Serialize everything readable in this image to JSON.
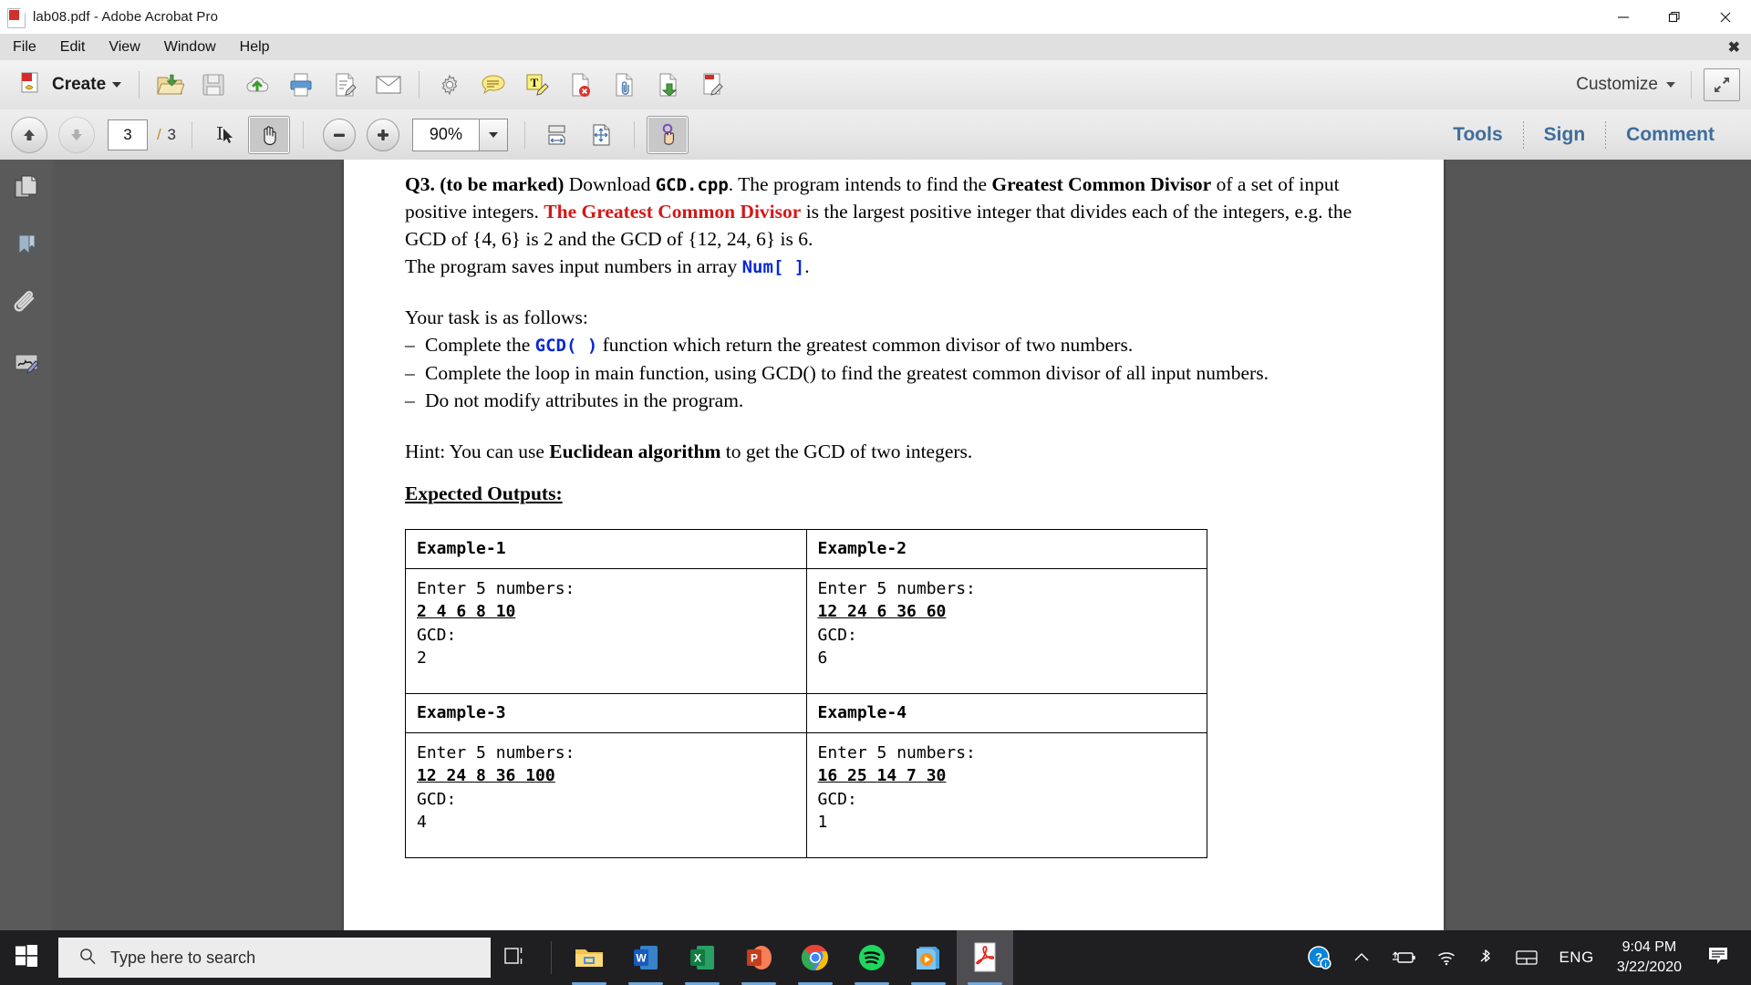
{
  "window": {
    "title": "lab08.pdf - Adobe Acrobat Pro",
    "app_icon": "acrobat-icon",
    "minimize": "—",
    "restore": "restore-icon",
    "close": "✕"
  },
  "menubar": {
    "items": [
      {
        "label": "File"
      },
      {
        "label": "Edit"
      },
      {
        "label": "View"
      },
      {
        "label": "Window"
      },
      {
        "label": "Help"
      }
    ],
    "close_doc": "✖"
  },
  "toolbar_main": {
    "create_label": "Create",
    "create_icon": "create-pdf-icon",
    "buttons": [
      {
        "name": "open-file-icon",
        "tip": "Open"
      },
      {
        "name": "save-icon",
        "tip": "Save"
      },
      {
        "name": "upload-cloud-icon",
        "tip": "Send for Signature"
      },
      {
        "name": "print-icon",
        "tip": "Print File"
      },
      {
        "name": "edit-text-icon",
        "tip": "Edit PDF"
      },
      {
        "name": "email-icon",
        "tip": "Email File"
      },
      {
        "name": "gear-icon",
        "tip": "Tools Settings"
      },
      {
        "name": "sticky-note-icon",
        "tip": "Add Sticky Note"
      },
      {
        "name": "highlight-text-icon",
        "tip": "Highlight Text"
      },
      {
        "name": "delete-page-icon",
        "tip": "Delete Pages"
      },
      {
        "name": "attach-file-icon",
        "tip": "Attach File"
      },
      {
        "name": "export-page-icon",
        "tip": "Export PDF"
      },
      {
        "name": "edit-pdf-icon",
        "tip": "Edit Document"
      }
    ],
    "customize_label": "Customize",
    "expand_icon": "expand-arrows-icon"
  },
  "toolbar_nav": {
    "prev_page_icon": "arrow-up-icon",
    "next_page_icon": "arrow-down-icon",
    "current_page": "3",
    "separator": "/",
    "total_pages": "3",
    "select_tool_icon": "text-select-icon",
    "hand_tool_icon": "hand-tool-icon",
    "zoom_out_icon": "minus-icon",
    "zoom_in_icon": "plus-icon",
    "zoom_value": "90%",
    "zoom_dropdown_icon": "chevron-down-icon",
    "fit_width_icon": "fit-width-icon",
    "fit_page_icon": "fit-page-icon",
    "pan_tool_icon": "pan-click-icon",
    "tabs": [
      {
        "label": "Tools"
      },
      {
        "label": "Sign"
      },
      {
        "label": "Comment"
      }
    ]
  },
  "sidebar": {
    "items": [
      {
        "name": "page-thumbnails-icon",
        "label": "Page Thumbnails"
      },
      {
        "name": "bookmarks-icon",
        "label": "Bookmarks"
      },
      {
        "name": "attachments-icon",
        "label": "Attachments"
      },
      {
        "name": "signatures-icon",
        "label": "Signatures"
      }
    ]
  },
  "document": {
    "q3": {
      "label": "Q3. (to be marked)",
      "t1": " Download ",
      "file": "GCD.cpp",
      "t2": ". The program intends to find the ",
      "bold1": "Greatest Common Divisor",
      "t3": " of a set of input positive integers. ",
      "red": "The Greatest Common Divisor",
      "t4": " is the largest positive integer that divides each of the integers, e.g. the GCD of {4, 6} is 2 and the GCD of {12, 24, 6} is 6."
    },
    "array_line": {
      "t1": "The program saves input numbers in array ",
      "code": "Num[ ]",
      "t2": "."
    },
    "task_heading": "Your task is as follows:",
    "tasks": [
      {
        "pre": "Complete the ",
        "code": "GCD( )",
        "post": " function which return the greatest common divisor of two numbers."
      },
      {
        "pre": "Complete the loop in main function, using GCD() to find the greatest common divisor of all input numbers.",
        "code": "",
        "post": ""
      },
      {
        "pre": "Do not modify attributes in the program.",
        "code": "",
        "post": ""
      }
    ],
    "hint": {
      "t1": "Hint: You can use ",
      "bold": "Euclidean algorithm",
      "t2": " to get the GCD of two integers."
    },
    "expected_outputs_heading": "Expected Outputs:",
    "examples": [
      {
        "title": "Example-1",
        "prompt": "Enter 5 numbers:",
        "input": "2 4 6 8 10",
        "gcd_label": "GCD:",
        "gcd_value": "2"
      },
      {
        "title": "Example-2",
        "prompt": "Enter 5 numbers:",
        "input": "12 24 6 36 60",
        "gcd_label": "GCD:",
        "gcd_value": "6"
      },
      {
        "title": "Example-3",
        "prompt": "Enter 5 numbers:",
        "input": "12 24 8 36 100",
        "gcd_label": "GCD:",
        "gcd_value": "4"
      },
      {
        "title": "Example-4",
        "prompt": "Enter 5 numbers:",
        "input": "16 25 14 7 30",
        "gcd_label": "GCD:",
        "gcd_value": "1"
      }
    ]
  },
  "taskbar": {
    "start_icon": "windows-start-icon",
    "search_placeholder": "Type here to search",
    "search_icon": "search-icon",
    "taskview_icon": "task-view-icon",
    "apps": [
      {
        "name": "file-explorer-icon",
        "label": "File Explorer",
        "running": true
      },
      {
        "name": "word-icon",
        "label": "Word",
        "running": true
      },
      {
        "name": "excel-icon",
        "label": "Excel",
        "running": true
      },
      {
        "name": "powerpoint-icon",
        "label": "PowerPoint",
        "running": true
      },
      {
        "name": "chrome-icon",
        "label": "Google Chrome",
        "running": true
      },
      {
        "name": "spotify-icon",
        "label": "Spotify",
        "running": true
      },
      {
        "name": "movies-tv-icon",
        "label": "Movies & TV",
        "running": true
      },
      {
        "name": "acrobat-icon",
        "label": "Adobe Acrobat Pro",
        "running": true,
        "active": true
      }
    ],
    "tray": [
      {
        "name": "help-info-icon"
      },
      {
        "name": "show-hidden-icons-icon"
      },
      {
        "name": "battery-charging-icon"
      },
      {
        "name": "wifi-icon"
      },
      {
        "name": "bluetooth-icon"
      },
      {
        "name": "touchpad-icon"
      }
    ],
    "language": "ENG",
    "time": "9:04 PM",
    "date": "3/22/2020",
    "notification_icon": "action-center-icon"
  },
  "colors": {
    "tab_blue": "#3e6d9c",
    "doc_red": "#d31818",
    "code_blue": "#0a28d8",
    "taskbar_bg": "#1f1f22",
    "doc_bg": "#565656"
  }
}
